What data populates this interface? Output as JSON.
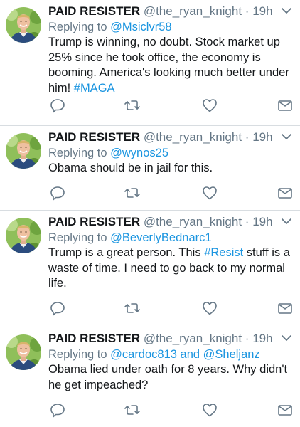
{
  "tweets": [
    {
      "display_name": "PAID RESISTER",
      "handle": "@the_ryan_knight",
      "separator": "·",
      "time": "19h",
      "replying_prefix": "Replying to ",
      "replying_to": "@Msiclvr58",
      "text_parts": [
        {
          "text": "Trump is winning, no doubt. Stock market up 25% since he took office, the economy is booming. America's looking much better under him! ",
          "link": false
        },
        {
          "text": "#MAGA",
          "link": true
        }
      ]
    },
    {
      "display_name": "PAID RESISTER",
      "handle": "@the_ryan_knight",
      "separator": "·",
      "time": "19h",
      "replying_prefix": "Replying to ",
      "replying_to": "@wynos25",
      "text_parts": [
        {
          "text": "Obama should be in jail for this.",
          "link": false
        }
      ]
    },
    {
      "display_name": "PAID RESISTER",
      "handle": "@the_ryan_knight",
      "separator": "·",
      "time": "19h",
      "replying_prefix": "Replying to ",
      "replying_to": "@BeverlyBednarc1",
      "text_parts": [
        {
          "text": "Trump is a great person. This ",
          "link": false
        },
        {
          "text": "#Resist",
          "link": true
        },
        {
          "text": " stuff is a waste of time. I need to go back to my normal life.",
          "link": false
        }
      ]
    },
    {
      "display_name": "PAID RESISTER",
      "handle": "@the_ryan_knight",
      "separator": "·",
      "time": "19h",
      "replying_prefix": "Replying to ",
      "replying_to": "@cardoc813 and @Sheljanz",
      "text_parts": [
        {
          "text": "Obama lied under oath for 8 years. Why didn't he get impeached?",
          "link": false
        }
      ]
    }
  ],
  "icons": {
    "reply": "reply-icon",
    "retweet": "retweet-icon",
    "like": "heart-icon",
    "message": "envelope-icon",
    "menu": "chevron-down-icon"
  },
  "colors": {
    "link": "#1b95e0",
    "secondary_text": "#657786",
    "primary_text": "#14171a",
    "icon": "#657786",
    "divider": "#d8dde1"
  }
}
